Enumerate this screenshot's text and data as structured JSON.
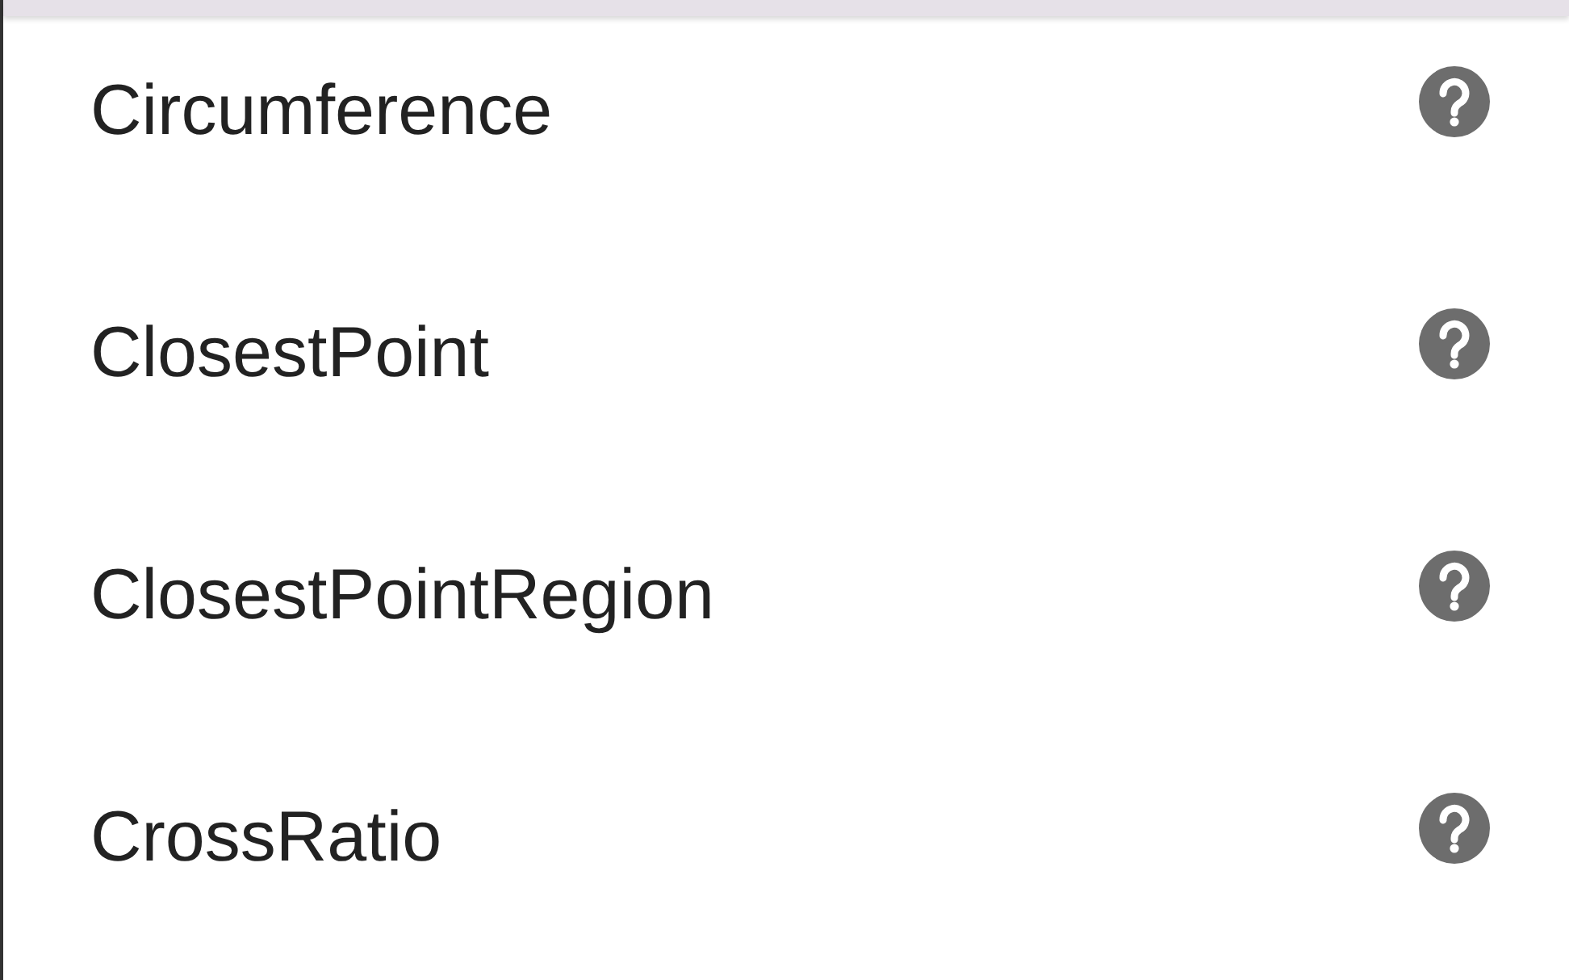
{
  "items": [
    {
      "label": "Circumference"
    },
    {
      "label": "ClosestPoint"
    },
    {
      "label": "ClosestPointRegion"
    },
    {
      "label": "CrossRatio"
    }
  ]
}
